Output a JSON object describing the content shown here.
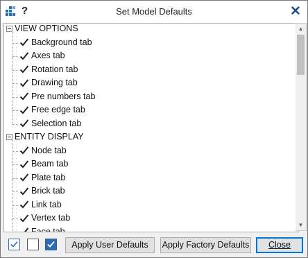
{
  "window": {
    "title": "Set Model Defaults",
    "help_label": "?",
    "close_glyph": "✕"
  },
  "colors": {
    "accent": "#0078d7",
    "check_fill": "#2f6ab0",
    "title_icon": "#1e6fc4"
  },
  "tree": {
    "groups": [
      {
        "label": "VIEW OPTIONS",
        "items": [
          {
            "label": "Background tab",
            "checked": true
          },
          {
            "label": "Axes tab",
            "checked": true
          },
          {
            "label": "Rotation tab",
            "checked": true
          },
          {
            "label": "Drawing tab",
            "checked": true
          },
          {
            "label": "Pre numbers tab",
            "checked": true
          },
          {
            "label": "Free edge tab",
            "checked": true
          },
          {
            "label": "Selection tab",
            "checked": true
          }
        ]
      },
      {
        "label": "ENTITY DISPLAY",
        "items": [
          {
            "label": "Node tab",
            "checked": true
          },
          {
            "label": "Beam tab",
            "checked": true
          },
          {
            "label": "Plate tab",
            "checked": true
          },
          {
            "label": "Brick tab",
            "checked": true
          },
          {
            "label": "Link tab",
            "checked": true
          },
          {
            "label": "Vertex tab",
            "checked": true
          },
          {
            "label": "Face tab",
            "checked": true
          }
        ]
      }
    ]
  },
  "footer": {
    "apply_user_defaults": "Apply User Defaults",
    "apply_factory_defaults": "Apply Factory Defaults",
    "close": "Close",
    "check_all_icon": "check-all-icon",
    "uncheck_all_icon": "uncheck-all-icon",
    "toggle_icon": "filled-check-icon"
  }
}
